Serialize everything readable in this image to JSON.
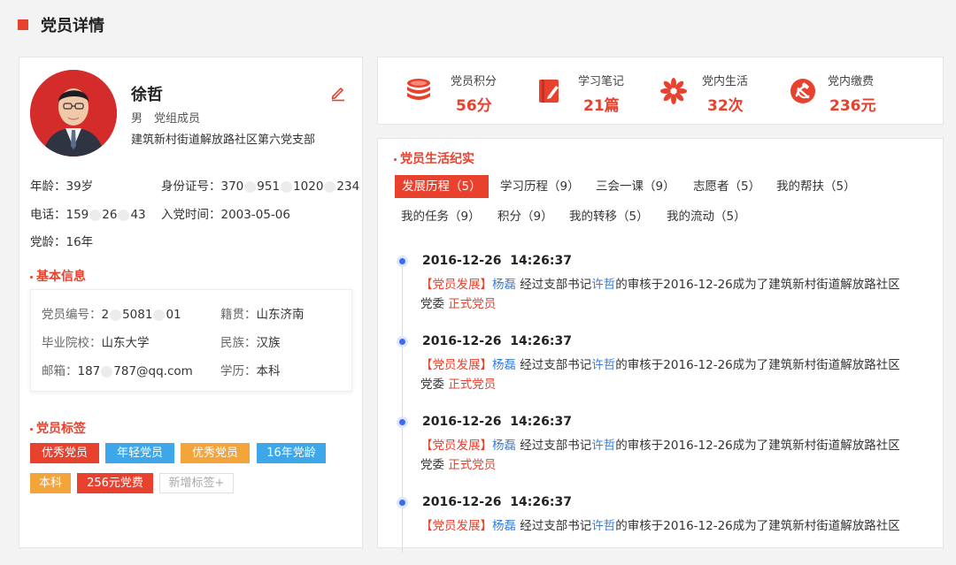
{
  "page": {
    "title": "党员详情"
  },
  "profile": {
    "name": "徐哲",
    "gender": "男",
    "role": "党组成员",
    "branch": "建筑新村街道解放路社区第六党支部",
    "age_label": "年龄：",
    "age_value": "39岁",
    "id_label": "身份证号：",
    "id_value_a": "370",
    "id_value_b": "951",
    "id_value_c": "1020",
    "id_value_d": "234",
    "phone_label": "电话：",
    "phone_value_a": "159",
    "phone_value_b": "26",
    "phone_value_c": "43",
    "join_label": "入党时间：",
    "join_value": "2003-05-06",
    "party_age_label": "党龄：",
    "party_age_value": "16年"
  },
  "basic": {
    "title": "基本信息",
    "member_no_label": "党员编号：",
    "member_no_a": "2",
    "member_no_b": "5081",
    "member_no_c": "01",
    "native_label": "籍贯：",
    "native_value": "山东济南",
    "school_label": "毕业院校：",
    "school_value": "山东大学",
    "ethnic_label": "民族：",
    "ethnic_value": "汉族",
    "email_label": "邮箱：",
    "email_a": "187",
    "email_b": "787@qq.com",
    "edu_label": "学历：",
    "edu_value": "本科"
  },
  "tags": {
    "title": "党员标签",
    "items": [
      {
        "label": "优秀党员",
        "color": "#e8412e"
      },
      {
        "label": "年轻党员",
        "color": "#3ea7ea"
      },
      {
        "label": "优秀党员",
        "color": "#f3a43b"
      },
      {
        "label": "16年党龄",
        "color": "#3ea7ea"
      },
      {
        "label": "本科",
        "color": "#f3a43b"
      },
      {
        "label": "256元党费",
        "color": "#e8412e"
      }
    ],
    "add_label": "新增标签+"
  },
  "stats": [
    {
      "label": "党员积分",
      "value": "56分",
      "icon": "coin-stack-icon"
    },
    {
      "label": "学习笔记",
      "value": "21篇",
      "icon": "notebook-icon"
    },
    {
      "label": "党内生活",
      "value": "32次",
      "icon": "flower-icon"
    },
    {
      "label": "党内缴费",
      "value": "236元",
      "icon": "party-emblem-icon"
    }
  ],
  "life": {
    "title": "党员生活纪实",
    "tabs": [
      "发展历程（5）",
      "学习历程（9）",
      "三会一课（9）",
      "志愿者（5）",
      "我的帮扶（5）",
      "我的任务（9）",
      "积分（9）",
      "我的转移（5）",
      "我的流动（5）"
    ],
    "records": [
      {
        "time": "2016-12-26  14:26:37",
        "category": "【党员发展】",
        "person": "杨磊",
        "t1": " 经过支部书记",
        "secretary": "许哲",
        "t2": "的审核于2016-12-26成为了建筑新村街道解放路社区党委 ",
        "status": "正式党员"
      },
      {
        "time": "2016-12-26  14:26:37",
        "category": "【党员发展】",
        "person": "杨磊",
        "t1": " 经过支部书记",
        "secretary": "许哲",
        "t2": "的审核于2016-12-26成为了建筑新村街道解放路社区党委 ",
        "status": "正式党员"
      },
      {
        "time": "2016-12-26  14:26:37",
        "category": "【党员发展】",
        "person": "杨磊",
        "t1": " 经过支部书记",
        "secretary": "许哲",
        "t2": "的审核于2016-12-26成为了建筑新村街道解放路社区党委 ",
        "status": "正式党员"
      },
      {
        "time": "2016-12-26  14:26:37",
        "category": "【党员发展】",
        "person": "杨磊",
        "t1": " 经过支部书记",
        "secretary": "许哲",
        "t2": "的审核于2016-12-26成为了建筑新村街道解放路社区",
        "status": ""
      }
    ]
  }
}
